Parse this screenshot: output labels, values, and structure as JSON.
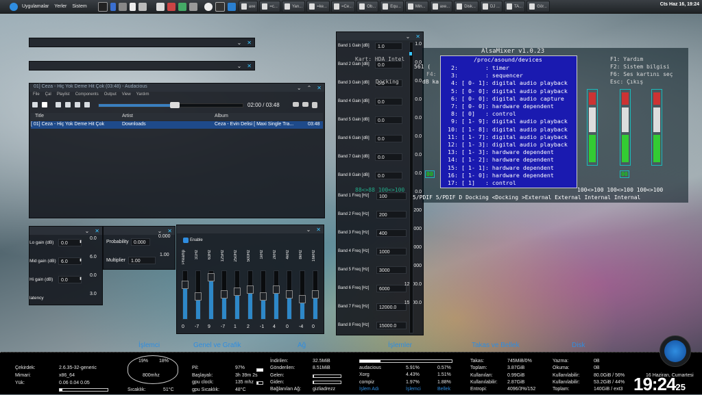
{
  "topbar": {
    "menus": [
      "Uygulamalar",
      "Yerler",
      "Sistem"
    ],
    "tasks": [
      "axe",
      "=c...",
      "Yan...",
      "=ke...",
      "=Ce...",
      "Ob...",
      "Equ...",
      "Min...",
      "axe...",
      "Disk...",
      "DJ ...",
      "TA...",
      "Gör..."
    ],
    "datetime": "Cts Haz 16, 19:24"
  },
  "audacious": {
    "title": "01] Ceza - Hiç Yok Deme Hit Çok (03:48) - Audacious",
    "menu": [
      "File",
      "Çal",
      "Playlist",
      "Components",
      "Output",
      "View",
      "Yardım"
    ],
    "time": "02:00 / 03:48",
    "columns": [
      "Title",
      "Artist",
      "Album"
    ],
    "row": {
      "title": "[ 01] Ceza - Hiç Yok Deme Hit Çok",
      "artist": "Downloads",
      "album": "Ceza - Evin Delisi [ Maxi Single Tra...",
      "length": "03:48"
    }
  },
  "eq_bands": {
    "gains": [
      {
        "label": "Band 1 Gain [dB]",
        "value": "1.0"
      },
      {
        "label": "Band 2 Gain [dB]",
        "value": "0.0"
      },
      {
        "label": "Band 3 Gain [dB]",
        "value": "0.0"
      },
      {
        "label": "Band 4 Gain [dB]",
        "value": "0.0"
      },
      {
        "label": "Band 5 Gain [dB]",
        "value": "0.0"
      },
      {
        "label": "Band 6 Gain [dB]",
        "value": "0.0"
      },
      {
        "label": "Band 7 Gain [dB]",
        "value": "0.0"
      },
      {
        "label": "Band 8 Gain [dB]",
        "value": "0.0"
      }
    ],
    "freqs": [
      {
        "label": "Band 1 Freq [Hz]",
        "value": "100"
      },
      {
        "label": "Band 2 Freq [Hz]",
        "value": "200"
      },
      {
        "label": "Band 3 Freq [Hz]",
        "value": "400"
      },
      {
        "label": "Band 4 Freq [Hz]",
        "value": "1000"
      },
      {
        "label": "Band 5 Freq [Hz]",
        "value": "3000"
      },
      {
        "label": "Band 6 Freq [Hz]",
        "value": "6000"
      },
      {
        "label": "Band 7 Freq [Hz]",
        "value": "12000.0"
      },
      {
        "label": "Band 8 Freq [Hz]",
        "value": "15000.0"
      }
    ],
    "scale": [
      "1.0",
      "0.0",
      "0.0",
      "0.0",
      "0.0",
      "0.0",
      "0.0",
      "0.0",
      "0.0",
      "200",
      "1000",
      "3000",
      "6000",
      "12000.0",
      "15000.0"
    ]
  },
  "alsamixer": {
    "title": "AlsaMixer v1.0.23",
    "dialog_title": "/proc/asound/devices",
    "rows": [
      " 2:        : timer",
      " 3:        : sequencer",
      " 4: [ 0- 1]: digital audio playback",
      " 5: [ 0- 0]: digital audio playback",
      " 6: [ 0- 0]: digital audio capture",
      " 7: [ 0- 0]: hardware dependent",
      " 8: [ 0]   : control",
      " 9: [ 1- 9]: digital audio playback",
      "10: [ 1- 8]: digital audio playback",
      "11: [ 1- 7]: digital audio playback",
      "12: [ 1- 3]: digital audio playback",
      "13: [ 1- 3]: hardware dependent",
      "14: [ 1- 2]: hardware dependent",
      "15: [ 1- 1]: hardware dependent",
      "16: [ 1- 0]: hardware dependent",
      "17: [ 1]   : control"
    ],
    "help": [
      "F1:  Yardım",
      "F2:  Sistem bilgisi",
      "F6:  Ses kartını seç",
      "Esc: Çıkış"
    ],
    "left_info": [
      "Kart:  HDA Intel",
      "F4:",
      "dB ka",
      "Docking"
    ],
    "bottom": "5/PDIF 5/PDIF D Docking <Docking >External External Internal Internal",
    "levels": "100<>100 100<>100 100<>100",
    "left_levels": "88<>88  100<>100",
    "num_left": "561 (",
    "badge": "00"
  },
  "small_panel": {
    "rows": [
      {
        "label": "Lo gain (dB)",
        "value": "0.0"
      },
      {
        "label": "Mid gain (dB)",
        "value": "6.0"
      },
      {
        "label": "Hi gain (dB)",
        "value": "0.0"
      },
      {
        "label": "latency",
        "value": "3.0"
      }
    ],
    "scale": [
      "0.0",
      "6.0",
      "0.0",
      "3.0"
    ]
  },
  "prob_panel": {
    "probability_label": "Probability",
    "probability_value": "0.000",
    "multiplier_label": "Multiplier",
    "multiplier_value": "1.00",
    "scale": [
      "0.000",
      "1.00"
    ]
  },
  "graphic_eq": {
    "enable": "Enable",
    "bands": [
      "Preamp",
      "31Hz",
      "63Hz",
      "125Hz",
      "250Hz",
      "500Hz",
      "1kHz",
      "2kHz",
      "4kHz",
      "8kHz",
      "16kHz"
    ],
    "values": [
      "0",
      "-7",
      "9",
      "-7",
      "1",
      "2",
      "-1",
      "4",
      "0",
      "-4",
      "0"
    ],
    "fill": [
      0.7,
      0.45,
      0.85,
      0.5,
      0.55,
      0.6,
      0.45,
      0.6,
      0.5,
      0.4,
      0.5
    ]
  },
  "conky": {
    "headers": {
      "cpu": "İşlemci",
      "general": "Genel ve Grafik",
      "net": "Ağ",
      "proc": "İşlemler",
      "swap": "Takas ve Bellek",
      "disk": "Disk"
    },
    "sys": [
      {
        "k": "Çekirdek:",
        "v": "2.6.35-32-generic"
      },
      {
        "k": "Mimari:",
        "v": "x86_64"
      },
      {
        "k": "Yük:",
        "v": "0.06 0.04 0.05"
      }
    ],
    "cpu_pct": [
      "19%",
      "18%"
    ],
    "cpu_freq": "800mhz",
    "cpu_temp_label": "Sıcaklık:",
    "cpu_temp": "51°C",
    "general": [
      {
        "k": "Pil:",
        "v": "97%"
      },
      {
        "k": "Başlayalı:",
        "v": "3h 39m 2s"
      },
      {
        "k": "gpu clock:",
        "v": "135 mhz"
      },
      {
        "k": "gpu Sıcaklık:",
        "v": "48°C"
      }
    ],
    "net": [
      {
        "k": "İndirilen:",
        "v": "32.5MiB"
      },
      {
        "k": "Gönderilen:",
        "v": "8.51MiB"
      },
      {
        "k": "Gelen:",
        "v": ""
      },
      {
        "k": "Giden:",
        "v": ""
      },
      {
        "k": "Bağlanılan Ağ:",
        "v": "gizliadrezz"
      }
    ],
    "procs": [
      {
        "n": "audacious",
        "c": "5.91%",
        "m": "0.57%"
      },
      {
        "n": "Xorg",
        "c": "4.43%",
        "m": "1.51%"
      },
      {
        "n": "compiz",
        "c": "1.97%",
        "m": "1.88%"
      }
    ],
    "proc_footer": [
      "İşlem Adı",
      "İşlemci",
      "Bellek"
    ],
    "swap": [
      {
        "k": "Takas:",
        "v": "745MiB/0%"
      },
      {
        "k": "Toplam:",
        "v": "3.87GiB"
      },
      {
        "k": "Kullanılan:",
        "v": "0.99GiB"
      },
      {
        "k": "Kullanılabilir:",
        "v": "2.87GiB"
      },
      {
        "k": "Entropi:",
        "v": "4096/3%/152"
      }
    ],
    "disk": [
      {
        "k": "Yazma:",
        "v": "0B"
      },
      {
        "k": "Okuma:",
        "v": "0B"
      },
      {
        "k": "Kullanılabilir:",
        "v": "80.0GiB / 56%"
      },
      {
        "k": "Kullanılabilir:",
        "v": "53.2GiB / 44%"
      },
      {
        "k": "Toplam:",
        "v": "140GiB / ext3"
      }
    ],
    "date": "16 Haziran, Cumartesi",
    "time_hm": "19:24",
    "time_s": "25"
  }
}
